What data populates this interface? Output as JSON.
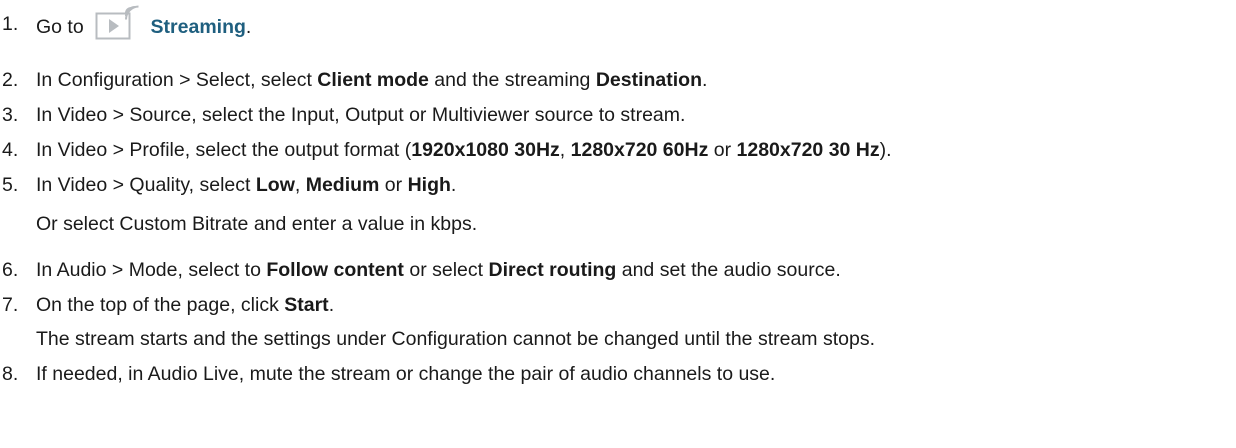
{
  "steps": [
    {
      "num": "1.",
      "parts": [
        "Go to",
        "Streaming",
        "."
      ]
    },
    {
      "num": "2.",
      "parts": [
        "In Configuration > Select, select ",
        "Client mode",
        " and the streaming ",
        "Destination",
        "."
      ]
    },
    {
      "num": "3.",
      "parts": [
        "In Video > Source, select the Input, Output or Multiviewer source to stream."
      ]
    },
    {
      "num": "4.",
      "parts": [
        "In Video > Profile, select the output format (",
        "1920x1080 30Hz",
        ", ",
        "1280x720 60Hz",
        " or ",
        "1280x720 30 Hz",
        ")."
      ]
    },
    {
      "num": "5.",
      "parts": [
        "In Video > Quality, select ",
        "Low",
        ", ",
        "Medium",
        " or ",
        "High",
        "."
      ],
      "sub": "Or select Custom Bitrate and enter a value in kbps."
    },
    {
      "num": "6.",
      "parts": [
        "In Audio > Mode, select to ",
        "Follow content",
        " or select ",
        "Direct routing",
        " and set the audio source."
      ]
    },
    {
      "num": "7.",
      "parts": [
        "On the top of the page, click ",
        "Start",
        "."
      ],
      "sub": "The stream starts and the settings under Configuration cannot be changed until the stream stops."
    },
    {
      "num": "8.",
      "parts": [
        "If needed, in Audio Live, mute the stream or change the pair of audio channels to use."
      ]
    }
  ],
  "icons": {
    "streaming": "streaming-icon"
  },
  "colors": {
    "link": "#1f5f7f",
    "text": "#1a1a1a",
    "icon": "#b8bcc0"
  }
}
